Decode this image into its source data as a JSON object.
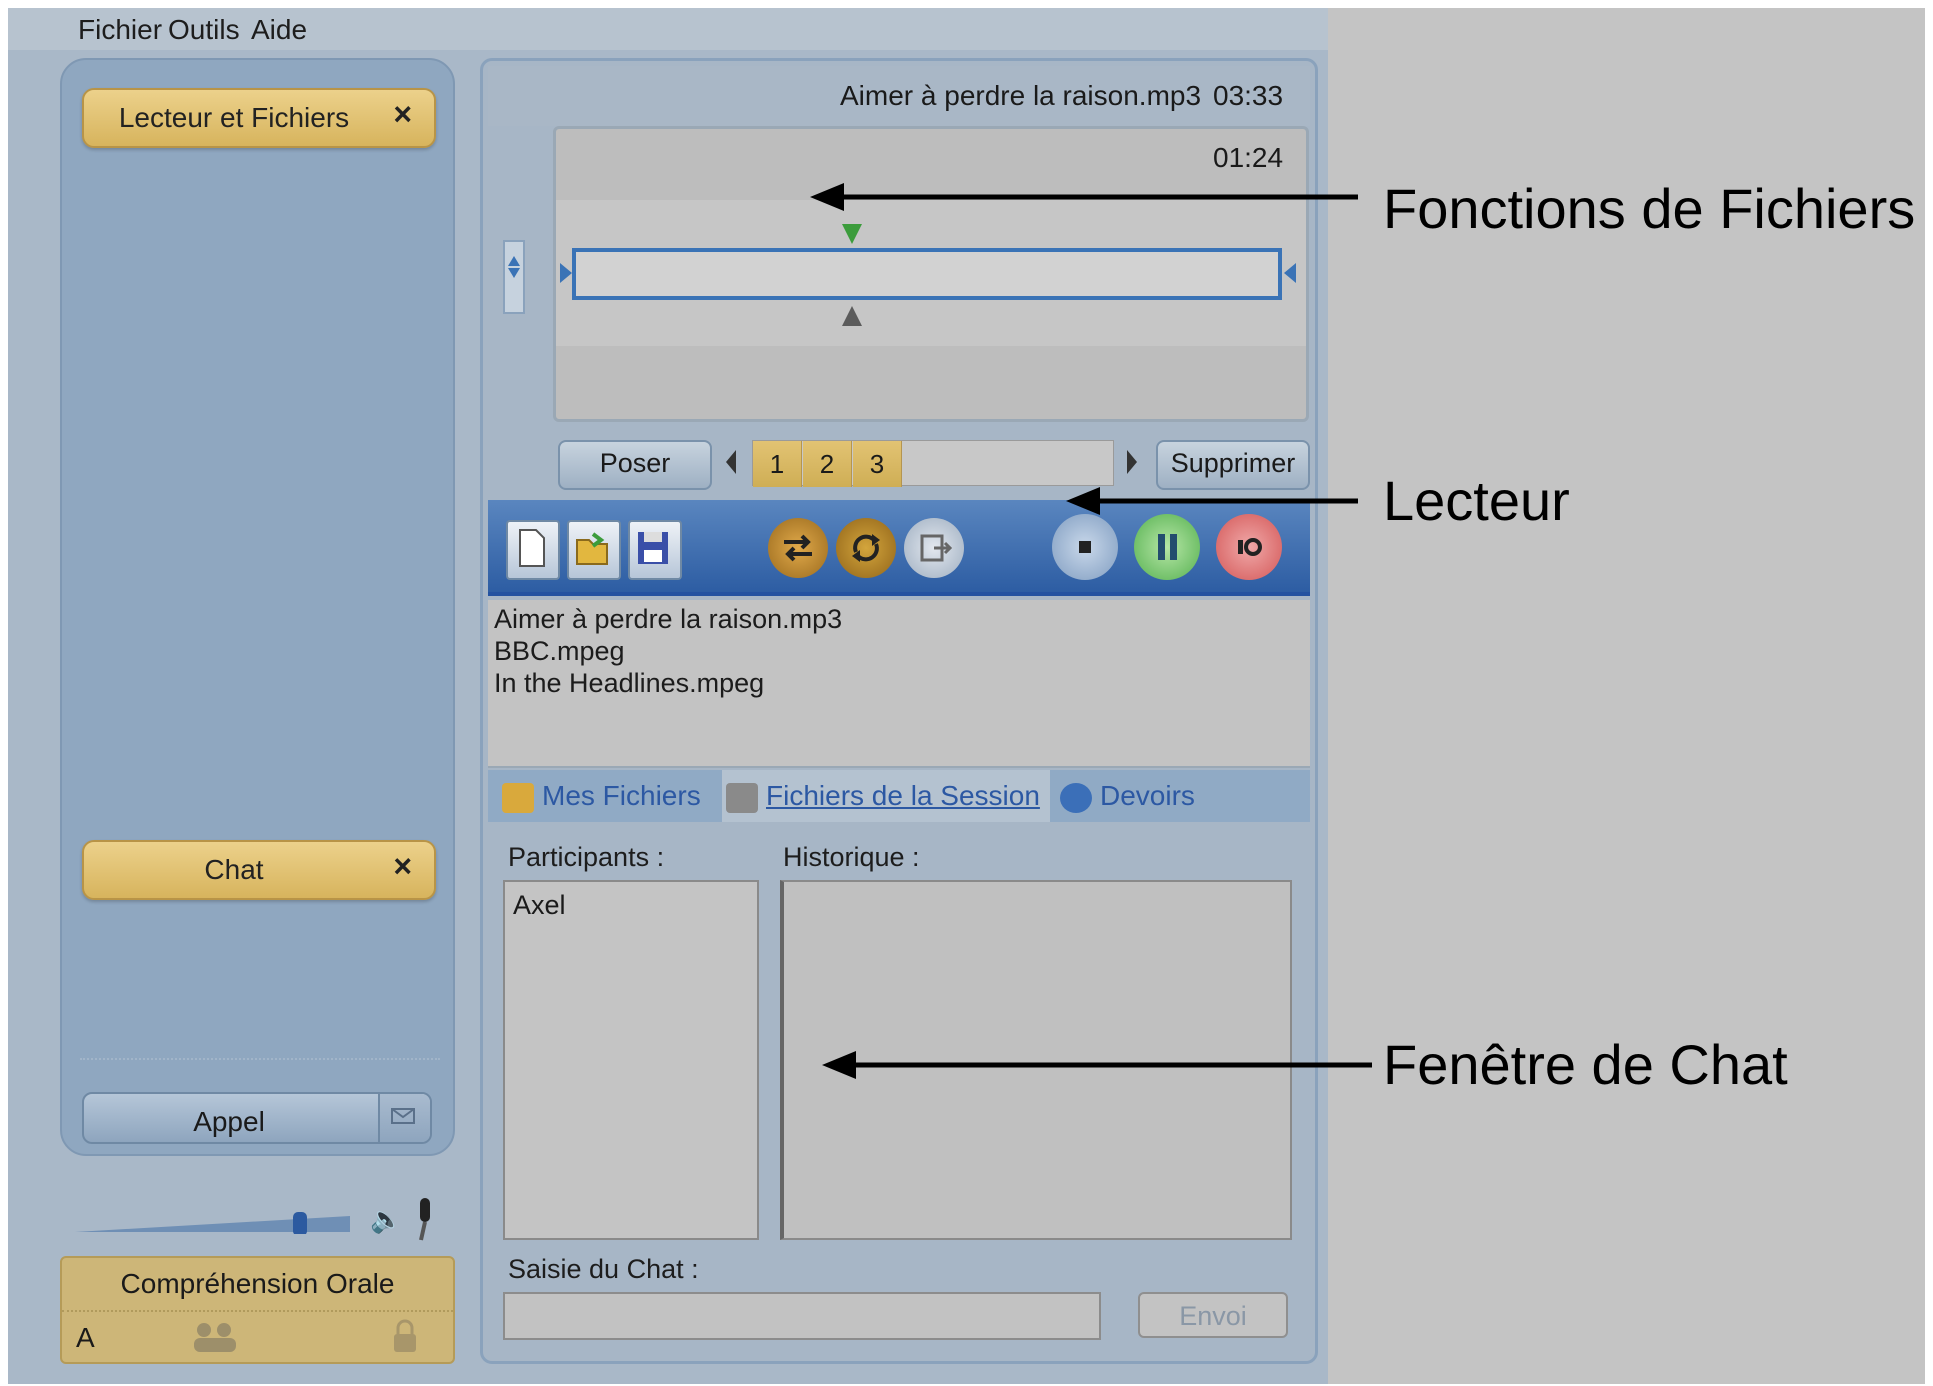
{
  "menubar": {
    "items": [
      "Fichier",
      "Outils",
      "Aide"
    ]
  },
  "left_panel": {
    "lecteur_button": {
      "label": "Lecteur et Fichiers",
      "close": "×"
    },
    "chat_button": {
      "label": "Chat",
      "close": "×"
    },
    "appel_button": {
      "label": "Appel"
    },
    "volume": {
      "level": 0.75
    },
    "module": {
      "title": "Compréhension Orale",
      "letter": "A"
    }
  },
  "file_functions": {
    "filename": "Aimer à perdre la raison.mp3",
    "duration": "03:33",
    "position": "01:24",
    "poser_label": "Poser",
    "supprimer_label": "Supprimer",
    "segments": [
      "1",
      "2",
      "3"
    ]
  },
  "player": {
    "toolbar_icons": [
      "new-file-icon",
      "open-folder-icon",
      "save-icon",
      "shuffle-icon",
      "repeat-icon",
      "export-icon",
      "stop-icon",
      "pause-icon",
      "record-icon"
    ],
    "files": [
      "Aimer à perdre la raison.mp3",
      "BBC.mpeg",
      "In the Headlines.mpeg"
    ]
  },
  "tabs": [
    {
      "label": "Mes Fichiers"
    },
    {
      "label": "Fichiers de la Session"
    },
    {
      "label": "Devoirs"
    }
  ],
  "chat": {
    "participants_label": "Participants :",
    "historique_label": "Historique :",
    "participants": [
      "Axel"
    ],
    "saisie_label": "Saisie du Chat :",
    "input_value": "",
    "envoi_label": "Envoi"
  },
  "annotations": {
    "fichiers": "Fonctions de Fichiers",
    "lecteur": "Lecteur",
    "chat": "Fenêtre de Chat"
  },
  "colors": {
    "accent_gold": "#d7b45d",
    "toolbar_blue": "#2d5da3",
    "panel_blue": "#8fa7c0"
  }
}
